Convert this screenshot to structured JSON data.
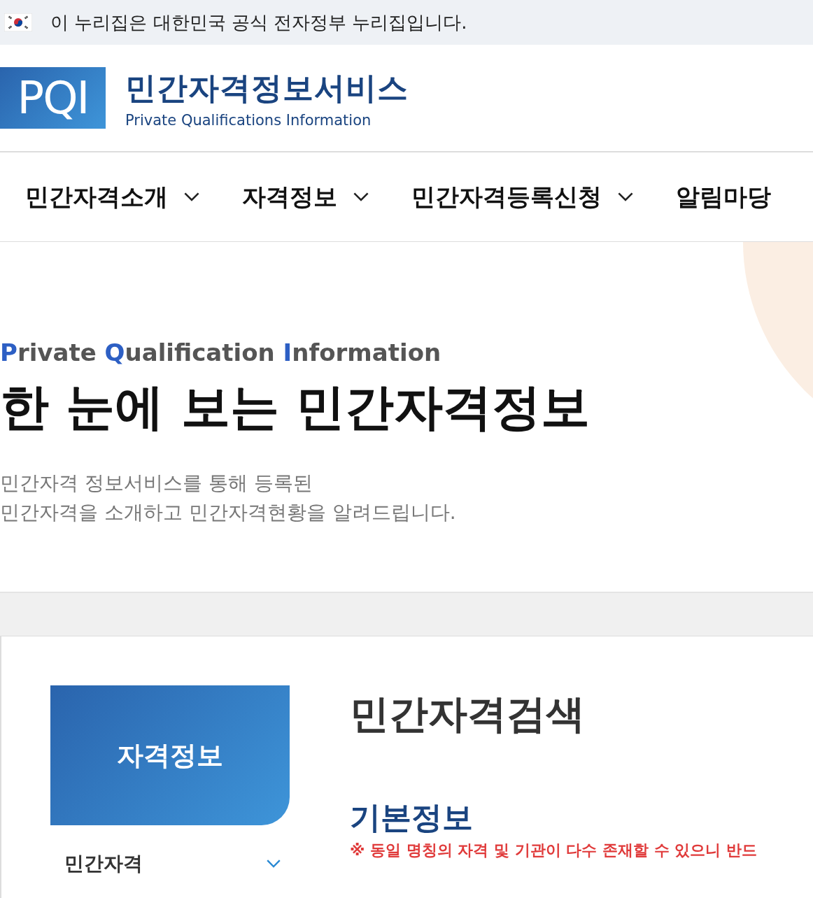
{
  "gov_banner": {
    "text": "이 누리집은 대한민국 공식 전자정부 누리집입니다."
  },
  "header": {
    "logo_mark": "PQI",
    "title": "민간자격정보서비스",
    "subtitle": "Private Qualifications Information"
  },
  "nav": [
    {
      "label": "민간자격소개",
      "chevron": true
    },
    {
      "label": "자격정보",
      "chevron": true
    },
    {
      "label": "민간자격등록신청",
      "chevron": true
    },
    {
      "label": "알림마당",
      "chevron": false
    }
  ],
  "hero": {
    "eyebrow": [
      {
        "text": "P",
        "accent": true
      },
      {
        "text": "rivate ",
        "accent": false
      },
      {
        "text": "Q",
        "accent": true
      },
      {
        "text": "ualification ",
        "accent": false
      },
      {
        "text": "I",
        "accent": true
      },
      {
        "text": "nformation",
        "accent": false
      }
    ],
    "title": "한 눈에 보는 민간자격정보",
    "lines": [
      "민간자격 정보서비스를 통해 등록된",
      "민간자격을 소개하고 민간자격현황을 알려드립니다."
    ]
  },
  "sidebar": {
    "title": "자격정보",
    "items": [
      {
        "label": "민간자격",
        "expanded": false
      }
    ]
  },
  "content": {
    "title": "민간자격검색",
    "section": "기본정보",
    "notice": "※ 동일 명칭의 자격 및 기관이 다수 존재할 수 있으니 반드"
  }
}
